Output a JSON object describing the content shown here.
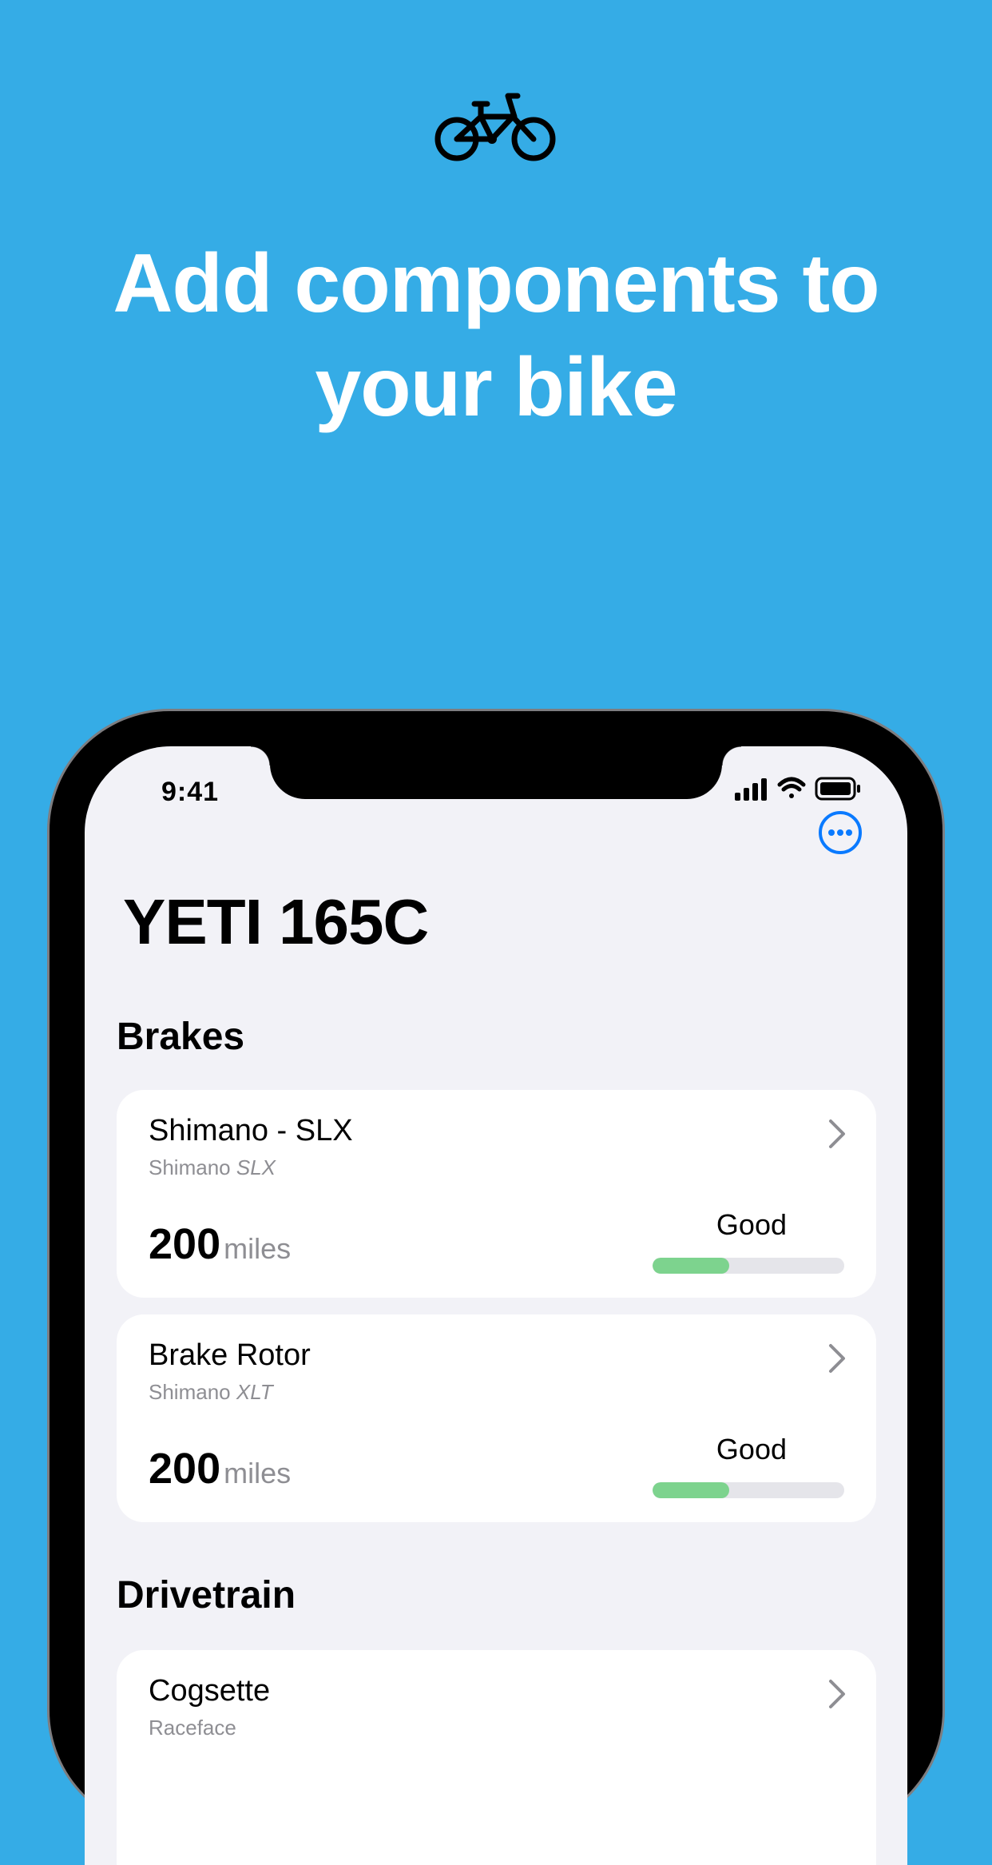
{
  "hero": {
    "icon": "bicycle-icon",
    "headline": "Add components to your bike"
  },
  "status_bar": {
    "time": "9:41",
    "icons": [
      "cellular-signal-icon",
      "wifi-icon",
      "battery-icon"
    ]
  },
  "nav": {
    "more_icon": "ellipsis-circle-icon",
    "accent": "#0A7AFF"
  },
  "page": {
    "title": "YETI 165C"
  },
  "sections": [
    {
      "title": "Brakes",
      "items": [
        {
          "name": "Shimano - SLX",
          "brand": "Shimano",
          "model": "SLX",
          "miles": "200",
          "unit": "miles",
          "condition": "Good",
          "wear": 0.4
        },
        {
          "name": "Brake Rotor",
          "brand": "Shimano",
          "model": "XLT",
          "miles": "200",
          "unit": "miles",
          "condition": "Good",
          "wear": 0.4
        }
      ]
    },
    {
      "title": "Drivetrain",
      "items": [
        {
          "name": "Cogsette",
          "brand": "Raceface",
          "model": ""
        }
      ]
    }
  ],
  "colors": {
    "background": "#35ACE6",
    "good": "#7DD38E"
  }
}
